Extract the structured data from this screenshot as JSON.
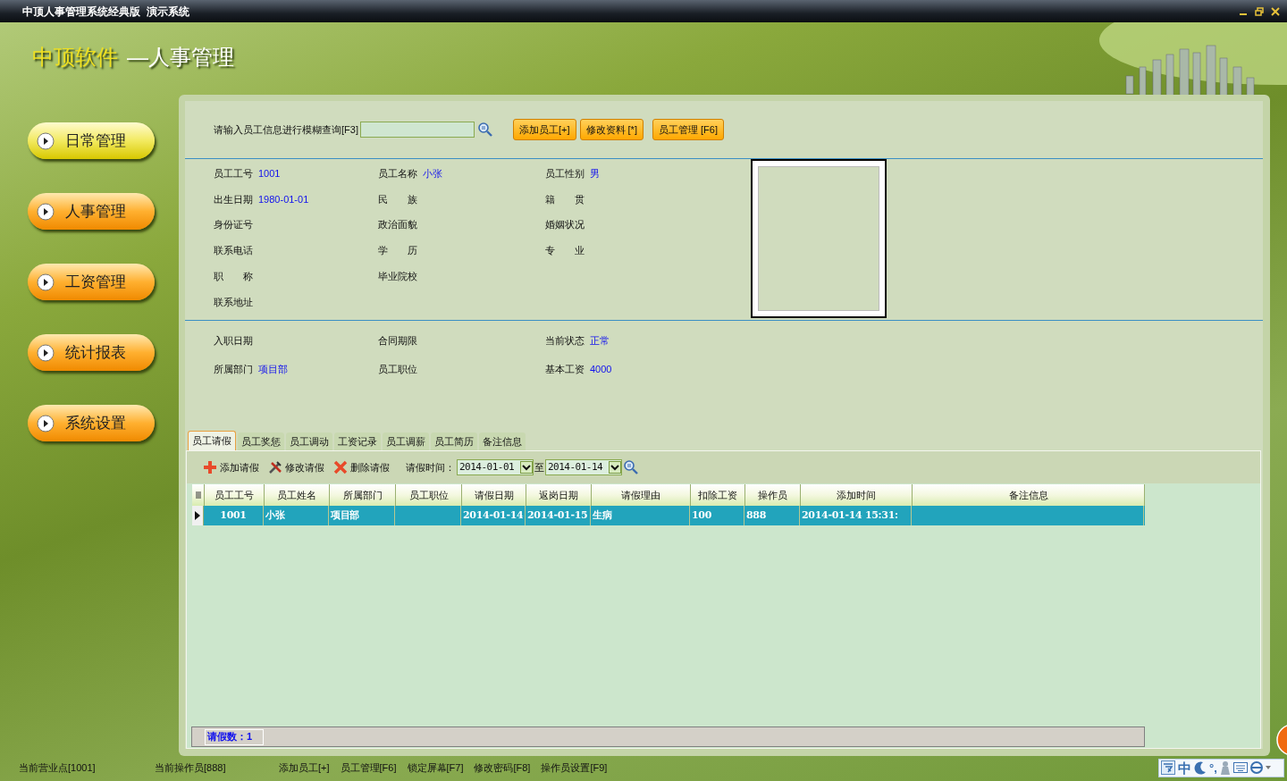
{
  "window": {
    "title": "中顶人事管理系统经典版  演示系统"
  },
  "logo": {
    "brand": "中顶软件",
    "subtitle": "—人事管理"
  },
  "nav": [
    {
      "label": "日常管理",
      "selected": true
    },
    {
      "label": "人事管理",
      "selected": false
    },
    {
      "label": "工资管理",
      "selected": false
    },
    {
      "label": "统计报表",
      "selected": false
    },
    {
      "label": "系统设置",
      "selected": false
    }
  ],
  "search": {
    "label": "请输入员工信息进行模糊查询[F3]"
  },
  "actions": [
    "添加员工[+]",
    "修改资料 [*]",
    "员工管理 [F6]"
  ],
  "info_rows": [
    [
      {
        "label": "员工工号",
        "value": "1001"
      },
      {
        "label": "员工名称",
        "value": "小张"
      },
      {
        "label": "员工性别",
        "value": "男"
      }
    ],
    [
      {
        "label": "出生日期",
        "value": "1980-01-01"
      },
      {
        "label": "民　　族"
      },
      {
        "label": "籍　　贯"
      }
    ],
    [
      {
        "label": "身份证号"
      },
      {
        "label": "政治面貌"
      },
      {
        "label": "婚姻状况"
      }
    ],
    [
      {
        "label": "联系电话"
      },
      {
        "label": "学　　历"
      },
      {
        "label": "专　　业"
      }
    ],
    [
      {
        "label": "职　　称"
      },
      {
        "label": "毕业院校"
      }
    ],
    [
      {
        "label": "联系地址"
      }
    ]
  ],
  "job_rows": [
    [
      {
        "label": "入职日期"
      },
      {
        "label": "合同期限"
      },
      {
        "label": "当前状态",
        "value": "正常"
      }
    ],
    [
      {
        "label": "所属部门",
        "value": "项目部"
      },
      {
        "label": "员工职位"
      },
      {
        "label": "基本工资",
        "value": "4000"
      }
    ]
  ],
  "tabs": [
    {
      "label": "员工请假",
      "selected": true
    },
    {
      "label": "员工奖惩",
      "selected": false
    },
    {
      "label": "员工调动",
      "selected": false
    },
    {
      "label": "工资记录",
      "selected": false
    },
    {
      "label": "员工调薪",
      "selected": false
    },
    {
      "label": "员工简历",
      "selected": false
    },
    {
      "label": "备注信息",
      "selected": false
    }
  ],
  "toolbar": [
    {
      "kind": "add",
      "label": "添加请假"
    },
    {
      "kind": "edit",
      "label": "修改请假"
    },
    {
      "kind": "delete",
      "label": "删除请假"
    }
  ],
  "date_filter": {
    "label": "请假时间：",
    "from": "2014-01-01",
    "separator": "至",
    "to": "2014-01-14"
  },
  "table": {
    "columns": [
      "员工工号",
      "员工姓名",
      "所属部门",
      "员工职位",
      "请假日期",
      "返岗日期",
      "请假理由",
      "扣除工资",
      "操作员",
      "添加时间",
      "备注信息"
    ],
    "rows": [
      {
        "selected": true,
        "cells": [
          "1001",
          "小张",
          "项目部",
          null,
          "2014-01-14",
          "2014-01-15",
          "生病",
          "100",
          "888",
          "2014-01-14 15:31:",
          null
        ]
      }
    ]
  },
  "record_count": "请假数：1",
  "status_bar": {
    "location": "当前营业点[1001]",
    "operator": "当前操作员[888]",
    "shortcuts": [
      "添加员工[+]",
      "员工管理[F6]",
      "锁定屏幕[F7]",
      "修改密码[F8]",
      "操作员设置[F9]"
    ]
  },
  "ime": {
    "mode": "中",
    "punctuation": "°,"
  }
}
